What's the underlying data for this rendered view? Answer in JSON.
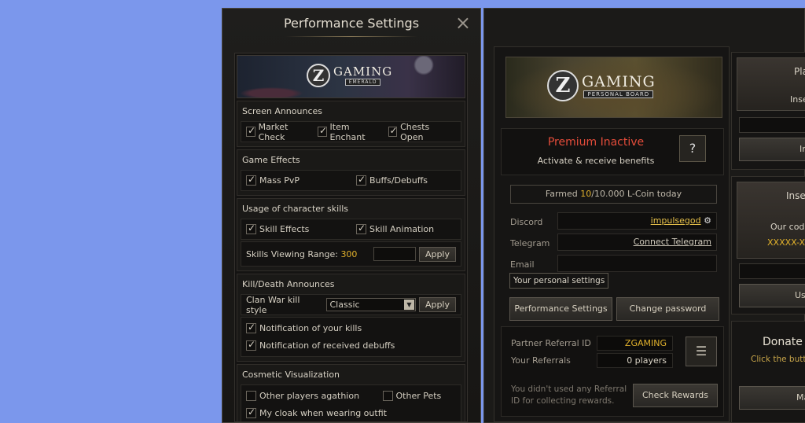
{
  "perf": {
    "title": "Performance Settings",
    "close_icon": "×",
    "banner": {
      "logo_letter": "Z",
      "logo_main": "GAMING",
      "logo_sub": "EMERALD"
    },
    "screen_announces": {
      "title": "Screen Announces",
      "items": [
        {
          "label": "Market Check",
          "checked": true
        },
        {
          "label": "Item Enchant",
          "checked": true
        },
        {
          "label": "Chests Open",
          "checked": true
        }
      ]
    },
    "game_effects": {
      "title": "Game Effects",
      "items": [
        {
          "label": "Mass PvP",
          "checked": true
        },
        {
          "label": "Buffs/Debuffs",
          "checked": true
        }
      ]
    },
    "skills": {
      "title": "Usage of character skills",
      "items": [
        {
          "label": "Skill Effects",
          "checked": true
        },
        {
          "label": "Skill Animation",
          "checked": true
        }
      ],
      "range_label": "Skills Viewing Range:",
      "range_value": "300",
      "range_input_value": "",
      "apply": "Apply"
    },
    "kill_death": {
      "title": "Kill/Death Announces",
      "clan_war_label": "Clan War kill style",
      "clan_war_value": "Classic",
      "apply": "Apply",
      "items": [
        {
          "label": "Notification of your kills",
          "checked": true
        },
        {
          "label": "Notification of received debuffs",
          "checked": true
        }
      ]
    },
    "cosmetic": {
      "title": "Cosmetic Visualization",
      "items": [
        {
          "label": "Other players agathion",
          "checked": false
        },
        {
          "label": "Other Pets",
          "checked": false
        },
        {
          "label": "My cloak when wearing outfit",
          "checked": true
        }
      ]
    }
  },
  "board": {
    "banner": {
      "logo_letter": "Z",
      "logo_main": "GAMING",
      "logo_sub": "PERSONAL BOARD"
    },
    "premium_status": "Premium Inactive",
    "premium_desc": "Activate & receive benefits",
    "help_icon": "?",
    "farmed_prefix": "Farmed ",
    "farmed_current": "10",
    "farmed_suffix": "/10.000 L-Coin today",
    "discord_label": "Discord",
    "discord_value": "impulsegod",
    "gear_icon": "⚙",
    "telegram_label": "Telegram",
    "telegram_value": "Connect Telegram",
    "email_label": "Email",
    "email_value": "",
    "tooltip": "Your personal settings",
    "perf_button": "Performance Settings",
    "password_button": "Change password",
    "partner_label": "Partner Referral ID",
    "partner_value": "ZGAMING",
    "referrals_label": "Your Referrals",
    "referrals_value": "0 players",
    "menu_icon": "☰",
    "ref_note": "You didn't used any Referral ID for collecting rewards.",
    "check_rewards": "Check Rewards"
  },
  "right": {
    "p1_title": "Pla",
    "p1_sub": "Inse",
    "p1_button": "In",
    "p2_title": "Inse",
    "p2_text1": "Our code",
    "p2_text2": "XXXXX-XX",
    "p2_button": "Us",
    "donate_title": "Donate &",
    "donate_sub": "Click the butto",
    "donate_button": "Mak"
  },
  "colors": {
    "accent_gold": "#e1b12c",
    "premium_red": "#e44c3a",
    "desktop_blue": "#7b97ec"
  }
}
